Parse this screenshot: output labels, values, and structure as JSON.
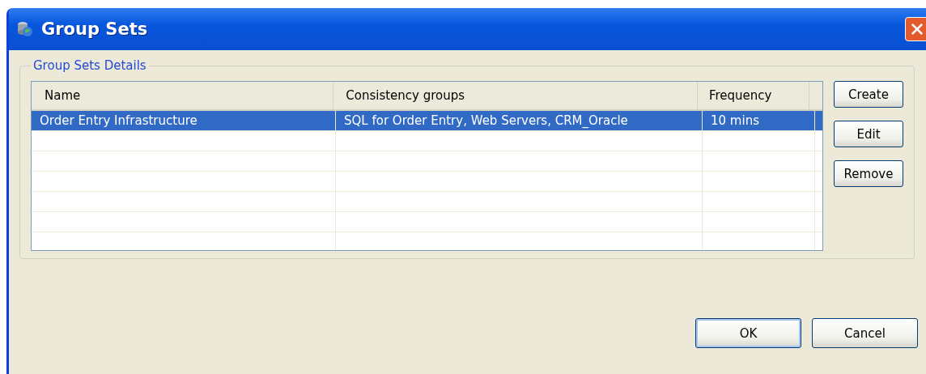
{
  "window": {
    "title": "Group Sets"
  },
  "group_box": {
    "title": "Group Sets Details"
  },
  "table": {
    "columns": [
      "Name",
      "Consistency groups",
      "Frequency"
    ],
    "rows": [
      {
        "cells": [
          "Order Entry Infrastructure",
          "SQL for Order Entry, Web Servers, CRM_Oracle",
          "10 mins"
        ],
        "selected": true
      }
    ]
  },
  "side_buttons": [
    "Create",
    "Edit",
    "Remove"
  ],
  "buttons": [
    {
      "label": "OK",
      "default": true
    },
    {
      "label": "Cancel",
      "default": false
    }
  ]
}
